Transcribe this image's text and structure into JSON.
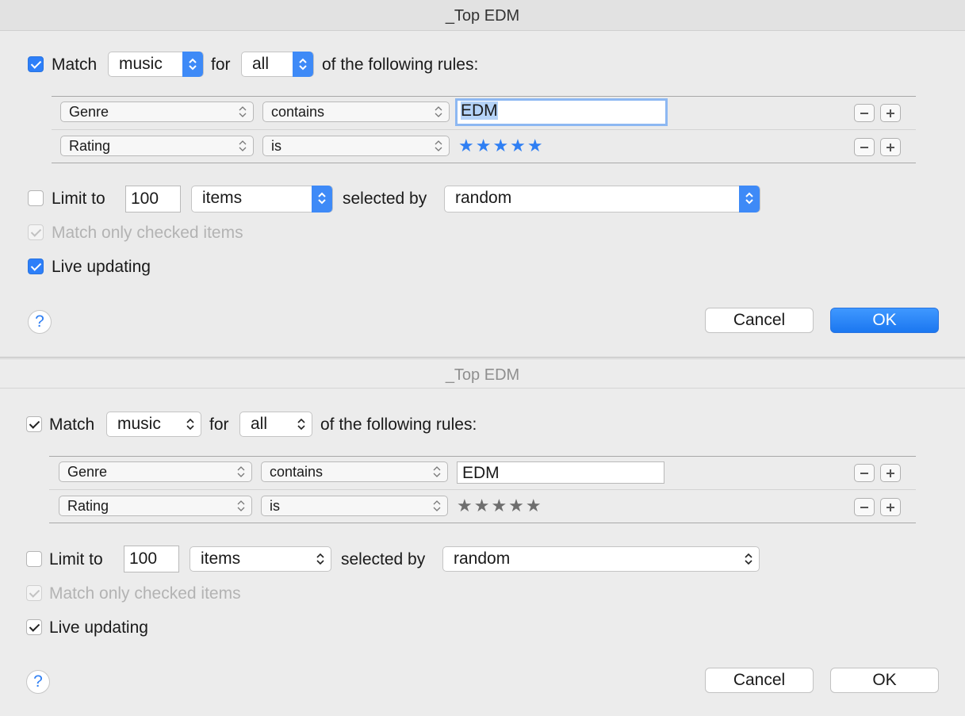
{
  "dialogs": [
    {
      "title": "_Top EDM",
      "style": "active",
      "match_label": "Match",
      "match_kind": "music",
      "for_label": "for",
      "for_value": "all",
      "following_label": "of the following rules:",
      "rules": [
        {
          "field": "Genre",
          "operator": "contains",
          "value": "EDM"
        },
        {
          "field": "Rating",
          "operator": "is",
          "value": "★★★★★"
        }
      ],
      "limit_label": "Limit to",
      "limit_value": "100",
      "limit_unit": "items",
      "selected_by_label": "selected by",
      "selected_by_value": "random",
      "match_checked_label": "Match only checked items",
      "live_updating_label": "Live updating",
      "help_label": "?",
      "cancel_label": "Cancel",
      "ok_label": "OK"
    },
    {
      "title": "_Top EDM",
      "style": "inactive",
      "match_label": "Match",
      "match_kind": "music",
      "for_label": "for",
      "for_value": "all",
      "following_label": "of the following rules:",
      "rules": [
        {
          "field": "Genre",
          "operator": "contains",
          "value": "EDM"
        },
        {
          "field": "Rating",
          "operator": "is",
          "value": "★★★★★"
        }
      ],
      "limit_label": "Limit to",
      "limit_value": "100",
      "limit_unit": "items",
      "selected_by_label": "selected by",
      "selected_by_value": "random",
      "match_checked_label": "Match only checked items",
      "live_updating_label": "Live updating",
      "help_label": "?",
      "cancel_label": "Cancel",
      "ok_label": "OK"
    }
  ],
  "colors": {
    "accent": "#2d7ff9",
    "default_button": "#1b77f0",
    "dim_text": "#b3b3b3"
  },
  "icons": [
    "checkbox-icon",
    "popup-arrows-icon",
    "minus-icon",
    "plus-icon",
    "help-icon",
    "star-icon"
  ]
}
